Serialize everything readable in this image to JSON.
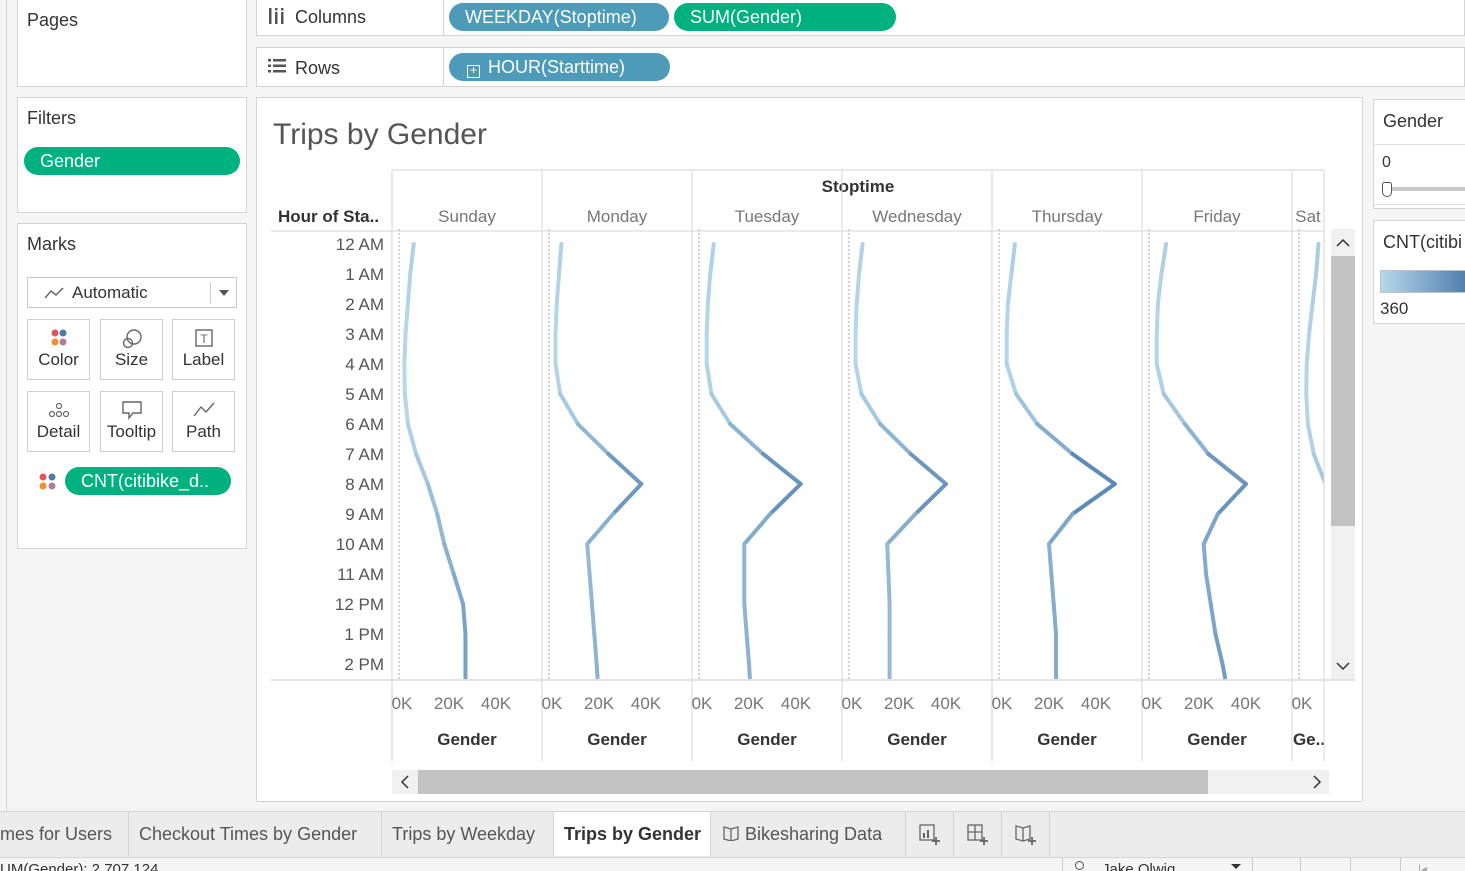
{
  "pages": {
    "title": "Pages"
  },
  "shelves": {
    "columns_label": "Columns",
    "rows_label": "Rows",
    "columns_pills": [
      "WEEKDAY(Stoptime)",
      "SUM(Gender)"
    ],
    "rows_pill": "HOUR(Starttime)"
  },
  "filters": {
    "title": "Filters",
    "pill": "Gender"
  },
  "marks": {
    "title": "Marks",
    "type_selected": "Automatic",
    "buttons": [
      "Color",
      "Size",
      "Label",
      "Detail",
      "Tooltip",
      "Path"
    ],
    "field_pill": "CNT(citibike_d.."
  },
  "legend": {
    "gender_title": "Gender",
    "gender_value": "0",
    "cnt_title": "CNT(citibi",
    "cnt_value": "360",
    "color_light": "#b7d7ea",
    "color_dark": "#4878a8"
  },
  "view": {
    "title": "Trips by Gender",
    "column_header": "Stoptime",
    "row_header": "Hour of Sta..",
    "axis_title": "Gender",
    "axis_title_last": "Ge..",
    "axis_ticks": [
      "0K",
      "20K",
      "40K"
    ]
  },
  "chart_data": {
    "type": "line",
    "title": "Trips by Gender",
    "row_field": "Hour of Starttime",
    "column_field": "Stoptime",
    "xlabel": "Gender",
    "xlim": [
      0,
      50000
    ],
    "categories": [
      "12 AM",
      "1 AM",
      "2 AM",
      "3 AM",
      "4 AM",
      "5 AM",
      "6 AM",
      "7 AM",
      "8 AM",
      "9 AM",
      "10 AM",
      "11 AM",
      "12 PM",
      "1 PM",
      "2 PM"
    ],
    "panels": [
      "Sunday",
      "Monday",
      "Tuesday",
      "Wednesday",
      "Thursday",
      "Friday",
      "Sat"
    ],
    "series": [
      {
        "name": "Sunday",
        "values": [
          5000,
          3500,
          2500,
          1500,
          1000,
          1200,
          2500,
          6000,
          11000,
          15000,
          18000,
          22000,
          26000,
          27000,
          27000
        ]
      },
      {
        "name": "Monday",
        "values": [
          4000,
          3000,
          2000,
          1500,
          1500,
          3500,
          11000,
          24000,
          38000,
          26000,
          15000,
          16000,
          17000,
          18000,
          19000
        ]
      },
      {
        "name": "Tuesday",
        "values": [
          5000,
          3500,
          2500,
          2000,
          2000,
          4000,
          12000,
          26000,
          42000,
          29000,
          18000,
          18000,
          18000,
          19000,
          20000
        ]
      },
      {
        "name": "Wednesday",
        "values": [
          4500,
          3000,
          2000,
          1500,
          1500,
          4000,
          12000,
          25000,
          40000,
          27000,
          15000,
          15500,
          16000,
          16000,
          16000
        ]
      },
      {
        "name": "Thursday",
        "values": [
          5500,
          4000,
          2500,
          2000,
          2000,
          6000,
          15000,
          30000,
          48000,
          30000,
          20000,
          21000,
          22000,
          23000,
          23000
        ]
      },
      {
        "name": "Friday",
        "values": [
          6000,
          4000,
          2500,
          2000,
          2000,
          5000,
          14000,
          24000,
          40000,
          28000,
          22000,
          23000,
          25000,
          27000,
          30000
        ]
      },
      {
        "name": "Sat",
        "values": [
          7000,
          6000,
          4500,
          3000,
          2000,
          1800,
          2500,
          5000,
          10000,
          14000,
          17000,
          20000,
          22000,
          23000,
          24000
        ]
      }
    ]
  },
  "tabs": {
    "items": [
      "mes for Users",
      "Checkout Times by Gender",
      "Trips by Weekday",
      "Trips by Gender",
      "Bikesharing Data"
    ],
    "active": "Trips by Gender"
  },
  "status": {
    "text": "UM(Gender): 2,707,124",
    "user": "Jake Olwig"
  }
}
